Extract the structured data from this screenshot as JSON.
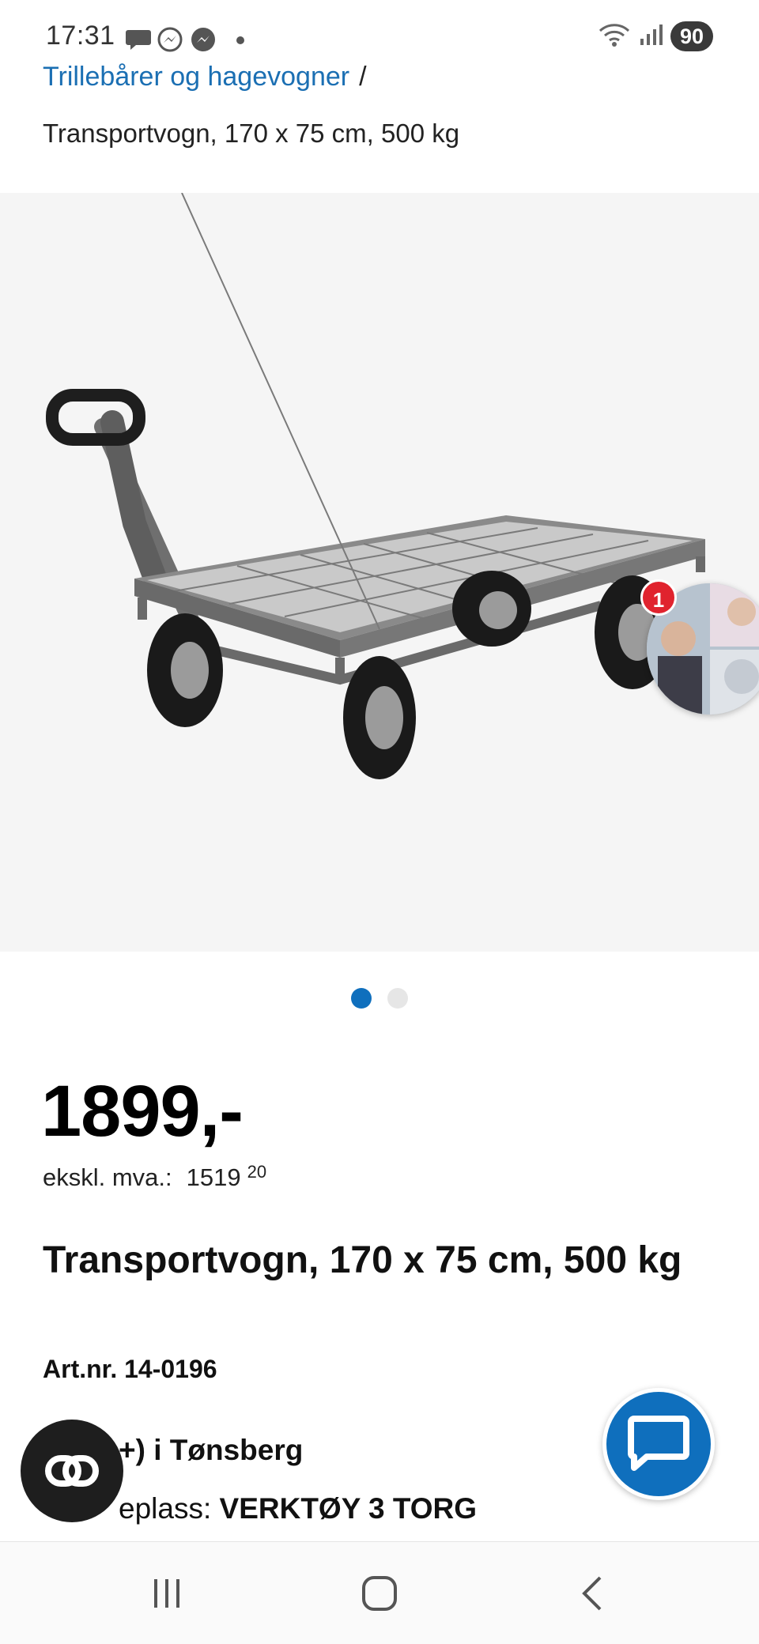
{
  "status_bar": {
    "time": "17:31",
    "battery": "90",
    "notification_icons": [
      "chat-bubble-icon",
      "messenger-icon",
      "messenger-icon",
      "dot-icon"
    ],
    "right_icons": [
      "wifi-icon",
      "signal-icon"
    ]
  },
  "breadcrumb": {
    "parent": "Trillebårer og hagevogner",
    "separator": "/",
    "current": "Transportvogn, 170 x 75 cm, 500 kg"
  },
  "gallery": {
    "image": "transport-cart-image",
    "dot_count": 2,
    "active_dot": 1,
    "chat_head_badge": "1"
  },
  "product": {
    "price": "1899,-",
    "ex_vat_label": "ekskl. mva.:",
    "ex_vat_main": "1519",
    "ex_vat_cents": "20",
    "title": "Transportvogn, 170 x 75 cm, 500 kg",
    "art_nr": "Art.nr. 14-0196",
    "stock": "+) i Tønsberg",
    "shelf_label": "eplass:",
    "shelf_value": "VERKTØY 3 TORG"
  },
  "colors": {
    "brand_blue": "#0f6fbd",
    "link_blue": "#1b6fb3",
    "badge_red": "#e0232e"
  },
  "nav": {
    "icons": [
      "recents-icon",
      "home-icon",
      "back-icon"
    ]
  }
}
